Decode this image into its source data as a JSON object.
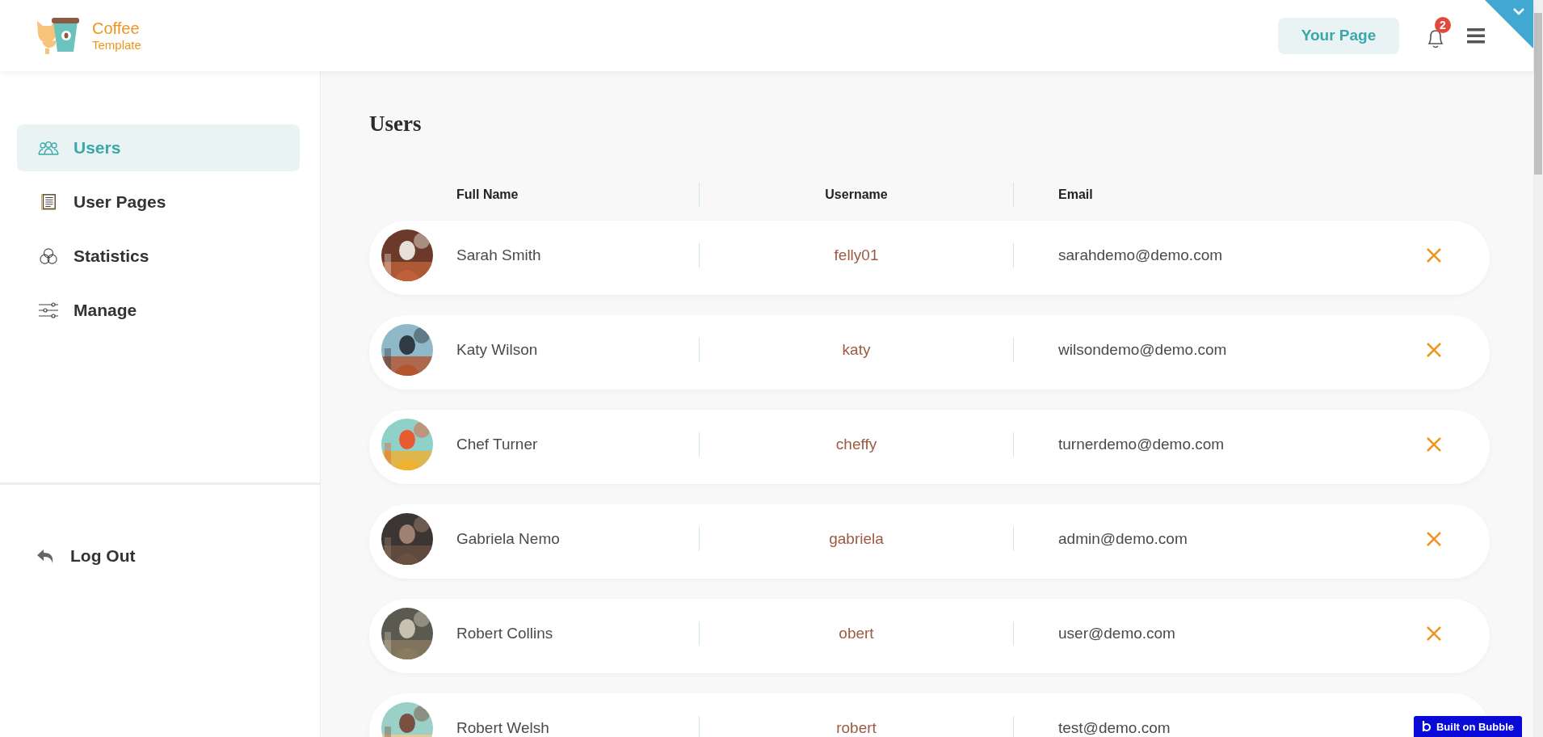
{
  "header": {
    "brand": {
      "name": "Coffee",
      "subtitle": "Template"
    },
    "your_page_button": "Your Page",
    "notifications": {
      "count": "2"
    }
  },
  "sidebar": {
    "items": [
      {
        "label": "Users",
        "kind": "users",
        "selected": true
      },
      {
        "label": "User Pages",
        "kind": "pages",
        "selected": false
      },
      {
        "label": "Statistics",
        "kind": "stats",
        "selected": false
      },
      {
        "label": "Manage",
        "kind": "manage",
        "selected": false
      }
    ],
    "logout": "Log Out"
  },
  "page": {
    "title": "Users"
  },
  "table": {
    "columns": [
      "Full Name",
      "Username",
      "Email"
    ],
    "rows": [
      {
        "full_name": "Sarah Smith",
        "username": "felly01",
        "email": "sarahdemo@demo.com"
      },
      {
        "full_name": "Katy  Wilson",
        "username": "katy",
        "email": "wilsondemo@demo.com"
      },
      {
        "full_name": "Chef Turner",
        "username": "cheffy",
        "email": "turnerdemo@demo.com"
      },
      {
        "full_name": "Gabriela Nemo",
        "username": "gabriela",
        "email": "admin@demo.com"
      },
      {
        "full_name": "Robert Collins",
        "username": "obert",
        "email": "user@demo.com"
      },
      {
        "full_name": "Robert Welsh",
        "username": "robert",
        "email": "test@demo.com"
      }
    ]
  },
  "badge": "Built on Bubble"
}
